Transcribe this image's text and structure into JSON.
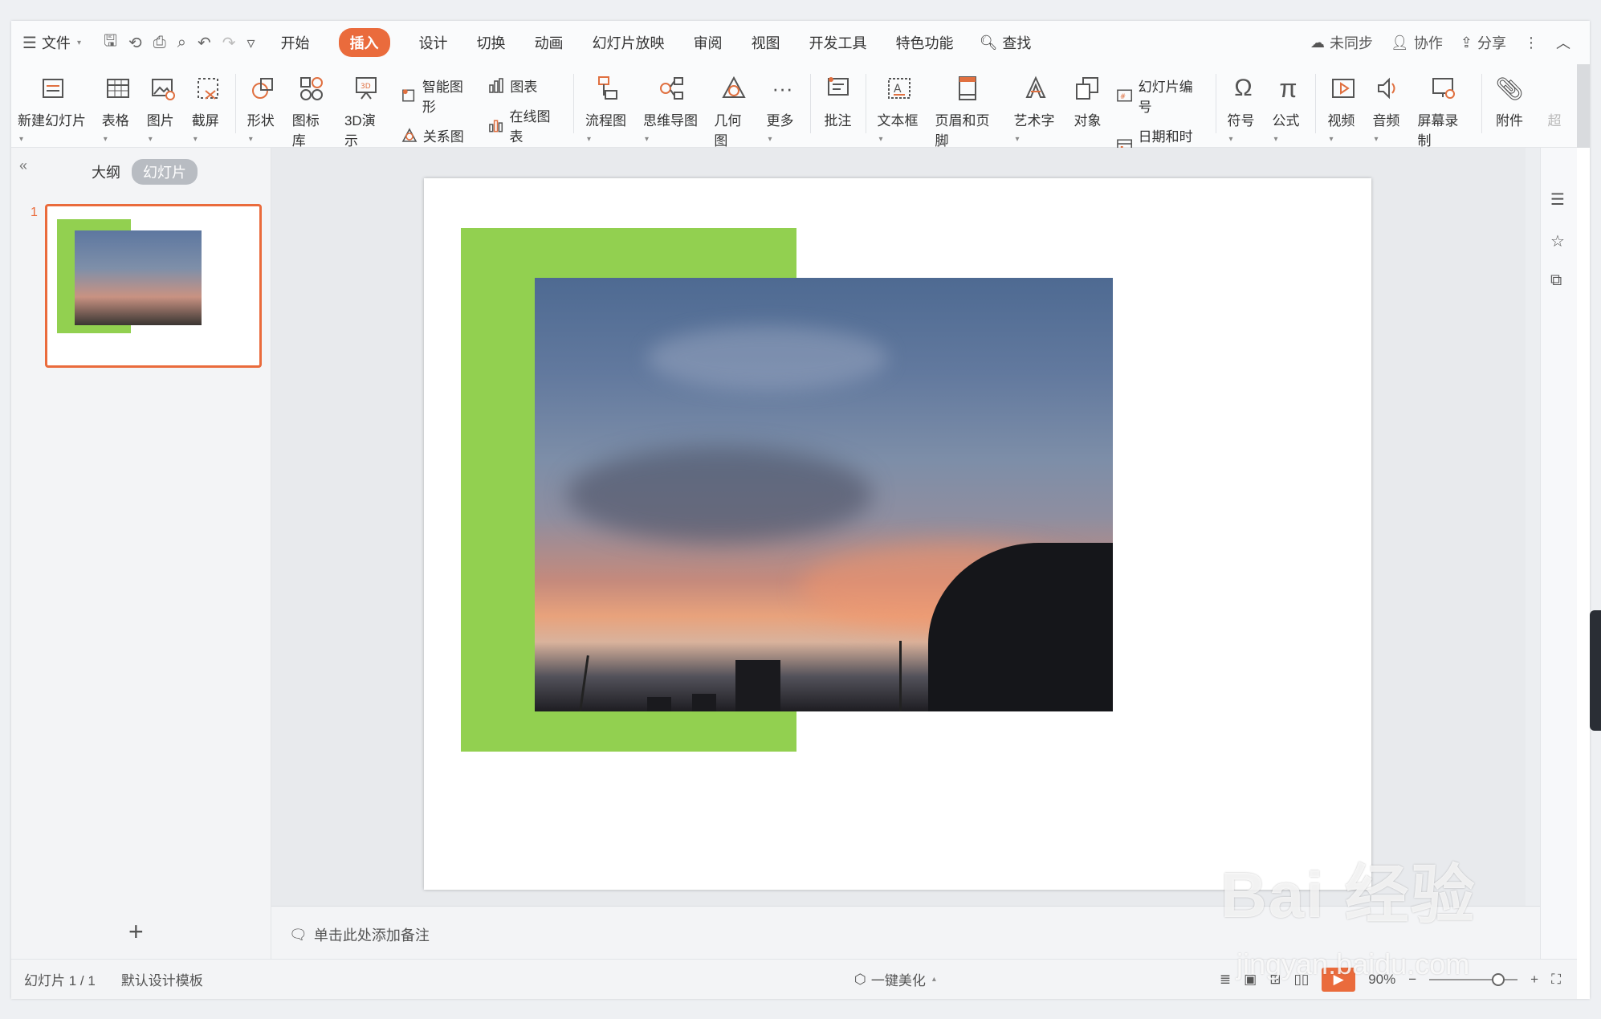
{
  "menubar": {
    "file_label": "文件",
    "tabs": [
      "开始",
      "插入",
      "设计",
      "切换",
      "动画",
      "幻灯片放映",
      "审阅",
      "视图",
      "开发工具",
      "特色功能"
    ],
    "active_tab": "插入",
    "search_label": "查找",
    "sync_label": "未同步",
    "collab_label": "协作",
    "share_label": "分享"
  },
  "ribbon": {
    "new_slide": "新建幻灯片",
    "table": "表格",
    "picture": "图片",
    "screenshot": "截屏",
    "shape": "形状",
    "icon_lib": "图标库",
    "demo3d": "3D演示",
    "smartart": "智能图形",
    "chart": "图表",
    "relation": "关系图",
    "online_chart": "在线图表",
    "flowchart": "流程图",
    "mindmap": "思维导图",
    "geometry": "几何图",
    "more": "更多",
    "comment": "批注",
    "textbox": "文本框",
    "header_footer": "页眉和页脚",
    "wordart": "艺术字",
    "object": "对象",
    "slide_number": "幻灯片编号",
    "datetime": "日期和时间",
    "symbol": "符号",
    "formula": "公式",
    "video": "视频",
    "audio": "音频",
    "screen_record": "屏幕录制",
    "attachment": "附件",
    "hyperlink_partial": "超"
  },
  "leftpanel": {
    "outline_tab": "大纲",
    "slides_tab": "幻灯片",
    "slide_number": "1"
  },
  "notes": {
    "placeholder": "单击此处添加备注"
  },
  "status": {
    "slide_info": "幻灯片 1 / 1",
    "template": "默认设计模板",
    "beautify": "一键美化",
    "zoom": "90%"
  },
  "slide": {
    "accent_color": "#92d050",
    "image_subject": "sunset sky photo"
  },
  "watermark": {
    "line1": "Bai 经验",
    "line2": "jingyan.baidu.com"
  },
  "colors": {
    "accent": "#ea6b3c",
    "green": "#92d050"
  }
}
